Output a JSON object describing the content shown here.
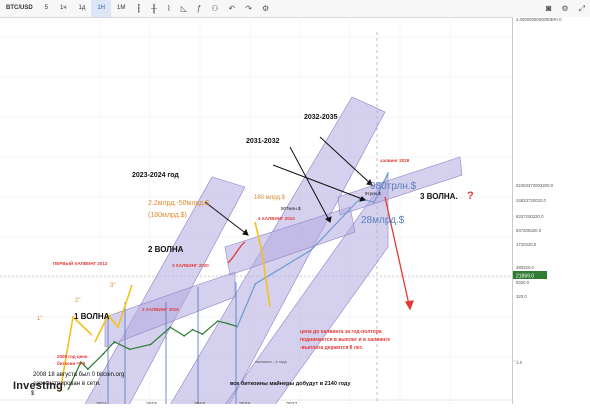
{
  "toolbar": {
    "symbol": "BTC/USD",
    "intervals": [
      "5",
      "1ч",
      "1д",
      "1Н",
      "1М"
    ],
    "active_interval": "1Н",
    "icons": [
      "candles-icon",
      "bars-icon",
      "line-icon",
      "area-icon",
      "indicators-icon",
      "compare-icon",
      "undo-icon",
      "redo-icon",
      "settings-icon"
    ],
    "right_icons": [
      "camera-icon",
      "gear-icon",
      "fullscreen-icon"
    ]
  },
  "price_scale": {
    "ticks": [
      "2.0000000000000ER+0",
      "02403372003200.0",
      "24833720032.0",
      "8337200320.0",
      "837208320.0",
      "1720320.0",
      "280320.0",
      "8320.0",
      "320.0",
      "1.0"
    ],
    "current_price": "21869.0"
  },
  "time_scale": {
    "ticks": [
      "2011",
      "2015",
      "2019",
      "2023",
      "2027"
    ]
  },
  "chart_data": {
    "type": "line",
    "symbol": "BTC/USD",
    "price_axis": "log",
    "x_ticks": [
      "2011",
      "2015",
      "2019",
      "2023",
      "2027"
    ],
    "price": [
      {
        "x": 2010.6,
        "y": 0.1
      },
      {
        "x": 2011.5,
        "y": 20
      },
      {
        "x": 2012.0,
        "y": 5
      },
      {
        "x": 2013.1,
        "y": 100
      },
      {
        "x": 2013.9,
        "y": 1100
      },
      {
        "x": 2015.0,
        "y": 250
      },
      {
        "x": 2016.5,
        "y": 650
      },
      {
        "x": 2017.9,
        "y": 19000
      },
      {
        "x": 2018.9,
        "y": 3500
      },
      {
        "x": 2019.5,
        "y": 12000
      },
      {
        "x": 2020.2,
        "y": 5000
      },
      {
        "x": 2021.3,
        "y": 63000
      },
      {
        "x": 2022.0,
        "y": 40000
      },
      {
        "x": 2022.7,
        "y": 21869
      }
    ],
    "forecast": [
      {
        "x": 2022.7,
        "y": 21869
      },
      {
        "x": 2024.0,
        "y": 100000000
      },
      {
        "x": 2028.0,
        "y": 80000000000
      },
      {
        "x": 2031.5,
        "y": 2000000000000000
      },
      {
        "x": 2032.5,
        "y": 980000000000000
      },
      {
        "x": 2033.5,
        "y": 300000000000000000
      }
    ]
  },
  "annotations": {
    "wave1": "1 ВОЛНА",
    "wave2": "2 ВОЛНА",
    "wave3": "3 ВОЛНА.",
    "question": "?",
    "label_1": "1\"",
    "label_2": "2\"",
    "label_3": "3\"",
    "first_halving": "ПЕРВЫЙ ХАЛВИНГ 2012",
    "halving2": "2 ХАЛВИНГ 2016",
    "halving3": "3 ХАЛВИНГ 2020",
    "halving4": "4 ХАЛВИНГ 2024",
    "halving_2028": "халвинг 2028",
    "period_2023_2024": "2023-2024 год",
    "period_2031_2032": "2031-2032",
    "period_2032_2035": "2032-2035",
    "forecast_1": "2.2млрд.-50млрд.$",
    "forecast_1b": "(180млрд.$)",
    "forecast_2": "180 млрд.$",
    "forecast_3": "980трлн.$",
    "forecast_4": "28млрд.$",
    "forecast_5": "507млн.$",
    "forecast_6": "9трлн.$",
    "start_2008_1": "2008 год цена",
    "start_2008_2": "биткоин =0 $",
    "note_2008_1": "2008 18 августа был 0 bitcoin.org",
    "note_2008_2": "зарегистрирован в сети.",
    "dollar": "$",
    "halving_note_1": "цена до халвинга за год-полтора",
    "halving_note_2": "поднимается в выплат и в халвинге",
    "halving_note_3": "-выплата держится 8 лет.",
    "mined_note": "все биткоины майнеры добудут в 2140 году",
    "halving_small": "халвинги - 4 года"
  },
  "brand": "Investing",
  "colors": {
    "channel": "#b3aae0",
    "channel_stroke": "#8c82c7",
    "price_line": "#2e7d32",
    "forecast_line": "#6b9bd1",
    "red": "#e53935",
    "orange": "#e08a2e",
    "yellow": "#f2c21b",
    "wave_blue": "#5b7fbf"
  }
}
